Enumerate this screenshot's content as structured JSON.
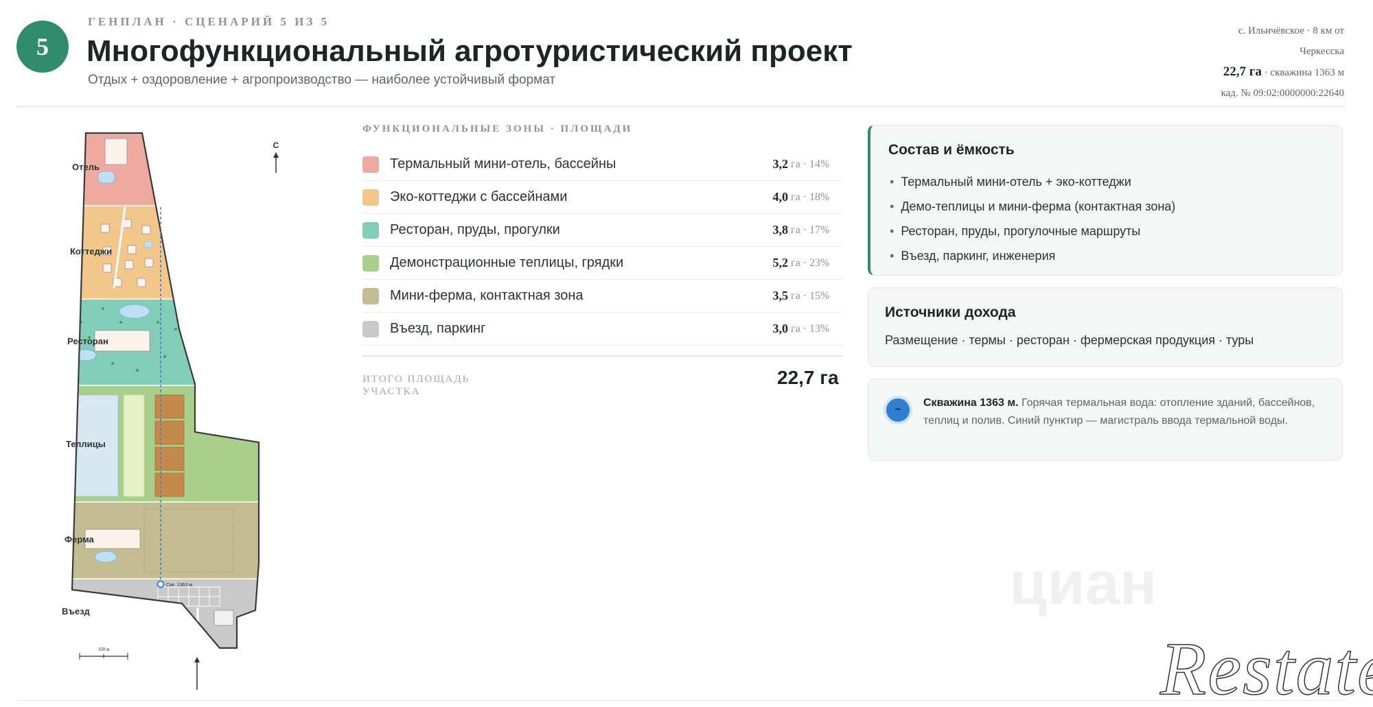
{
  "header": {
    "badge": "5",
    "kicker": "Генплан · Сценарий 5 из 5",
    "title": "Многофункциональный агротуристический проект",
    "subtitle": "Отдых + оздоровление + агропроизводство — наиболее устойчивый формат",
    "meta": {
      "location_line1": "с. Ильичёвское · 8 км от",
      "location_line2": "Черкесска",
      "area": "22,7 га",
      "well": " · скважина 1363 м",
      "cadastral": "кад. № 09:02:0000000:22640"
    }
  },
  "map": {
    "north": "С",
    "labels": {
      "hotel": "Отель",
      "cottages": "Коттеджи",
      "restaurant": "Ресторан",
      "greenhouses": "Теплицы",
      "farm": "Ферма",
      "entrance": "Въезд",
      "well": "Скв. 1363 м"
    },
    "scale": "100 м",
    "colors": {
      "hotel": "#eeaaa0",
      "cottages": "#f3c78a",
      "restaurant": "#82cdb8",
      "greenhouses": "#a9d08a",
      "farm": "#c4bd92",
      "entrance": "#c9c9c9",
      "pipe": "#3a7fd4"
    }
  },
  "zones": {
    "heading": "Функциональные зоны · площади",
    "items": [
      {
        "name": "Термальный мини-отель, бассейны",
        "value": "3,2",
        "unit": "га · 14%",
        "color": "#eeaaa0"
      },
      {
        "name": "Эко-коттеджи с бассейнами",
        "value": "4,0",
        "unit": "га · 18%",
        "color": "#f3c78a"
      },
      {
        "name": "Ресторан, пруды, прогулки",
        "value": "3,8",
        "unit": "га · 17%",
        "color": "#82cdb8"
      },
      {
        "name": "Демонстрационные теплицы, грядки",
        "value": "5,2",
        "unit": "га · 23%",
        "color": "#a9d08a"
      },
      {
        "name": "Мини-ферма, контактная зона",
        "value": "3,5",
        "unit": "га · 15%",
        "color": "#c4bd92"
      },
      {
        "name": "Въезд, паркинг",
        "value": "3,0",
        "unit": "га · 13%",
        "color": "#c9c9c9"
      }
    ],
    "total_label": "Итого площадь участка",
    "total_value": "22,7 га"
  },
  "cards": {
    "composition": {
      "title": "Состав и ёмкость",
      "items": [
        "Термальный мини-отель + эко-коттеджи",
        "Демо-теплицы и мини-ферма (контактная зона)",
        "Ресторан, пруды, прогулочные маршруты",
        "Въезд, паркинг, инженерия"
      ]
    },
    "income": {
      "title": "Источники дохода",
      "text": "Размещение · термы · ресторан · фермерская продукция · туры"
    },
    "well": {
      "icon": "~",
      "bold": "Скважина 1363 м.",
      "text": " Горячая термальная вода: отопление зданий, бассейнов, теплиц и полив. Синий пунктир — магистраль ввода термальной воды."
    }
  },
  "watermarks": {
    "cian": "циан",
    "restate": "Restate"
  }
}
